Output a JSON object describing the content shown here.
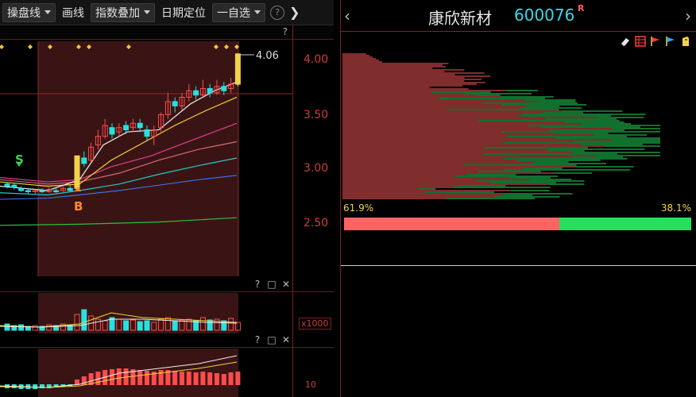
{
  "toolbar": {
    "items": [
      {
        "label": "操盘线",
        "dropdown": true
      },
      {
        "label": "画线",
        "dropdown": false
      },
      {
        "label": "指数叠加",
        "dropdown": true
      },
      {
        "label": "日期定位",
        "dropdown": false
      },
      {
        "label": "一自选",
        "dropdown": true
      }
    ],
    "help_label": "?",
    "collapse_label": "❯"
  },
  "main_chart": {
    "help_label": "?",
    "last_price_label": "4.06",
    "signal_s": "S",
    "signal_b": "B",
    "y_ticks": [
      "4.00",
      "3.50",
      "3.00",
      "2.50"
    ],
    "colors": {
      "up": "#ff4b4b",
      "down": "#29e0e0",
      "ma_white": "#f0f0f0",
      "ma_yellow": "#f2d43a",
      "ma_pink": "#e0408e",
      "ma_cyan": "#2ac6c6",
      "ma_blue": "#3d6de0",
      "ma_green": "#2cbf3c",
      "highlight": "#4a1a1a"
    }
  },
  "volume_pane": {
    "buttons": [
      "?",
      "□",
      "✕"
    ],
    "axis_label": "x1000"
  },
  "indicator_pane": {
    "buttons": [
      "?",
      "□",
      "✕"
    ],
    "axis_label": "10"
  },
  "right_panel": {
    "prev_label": "‹",
    "next_label": "›",
    "stock_name": "康欣新材",
    "stock_code": "600076",
    "stock_flag": "R",
    "left_pct": "61.9%",
    "right_pct": "38.1%",
    "red_share": 0.619,
    "icons": [
      "eraser-icon",
      "grid-icon",
      "red-flag-icon",
      "blue-flag-icon",
      "export-icon"
    ]
  }
}
